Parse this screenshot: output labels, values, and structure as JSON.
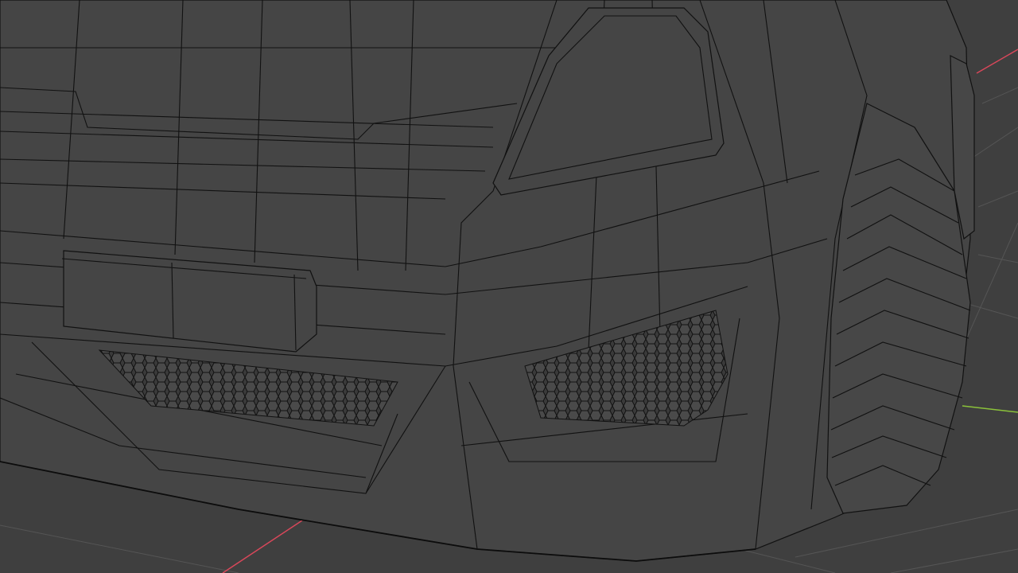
{
  "viewport": {
    "mode": "wireframe",
    "background_color": "#3f3f3f",
    "grid_color": "#555555",
    "wire_color": "#111111",
    "axis_x_color": "#d9475a",
    "axis_y_color": "#8bc23a"
  }
}
